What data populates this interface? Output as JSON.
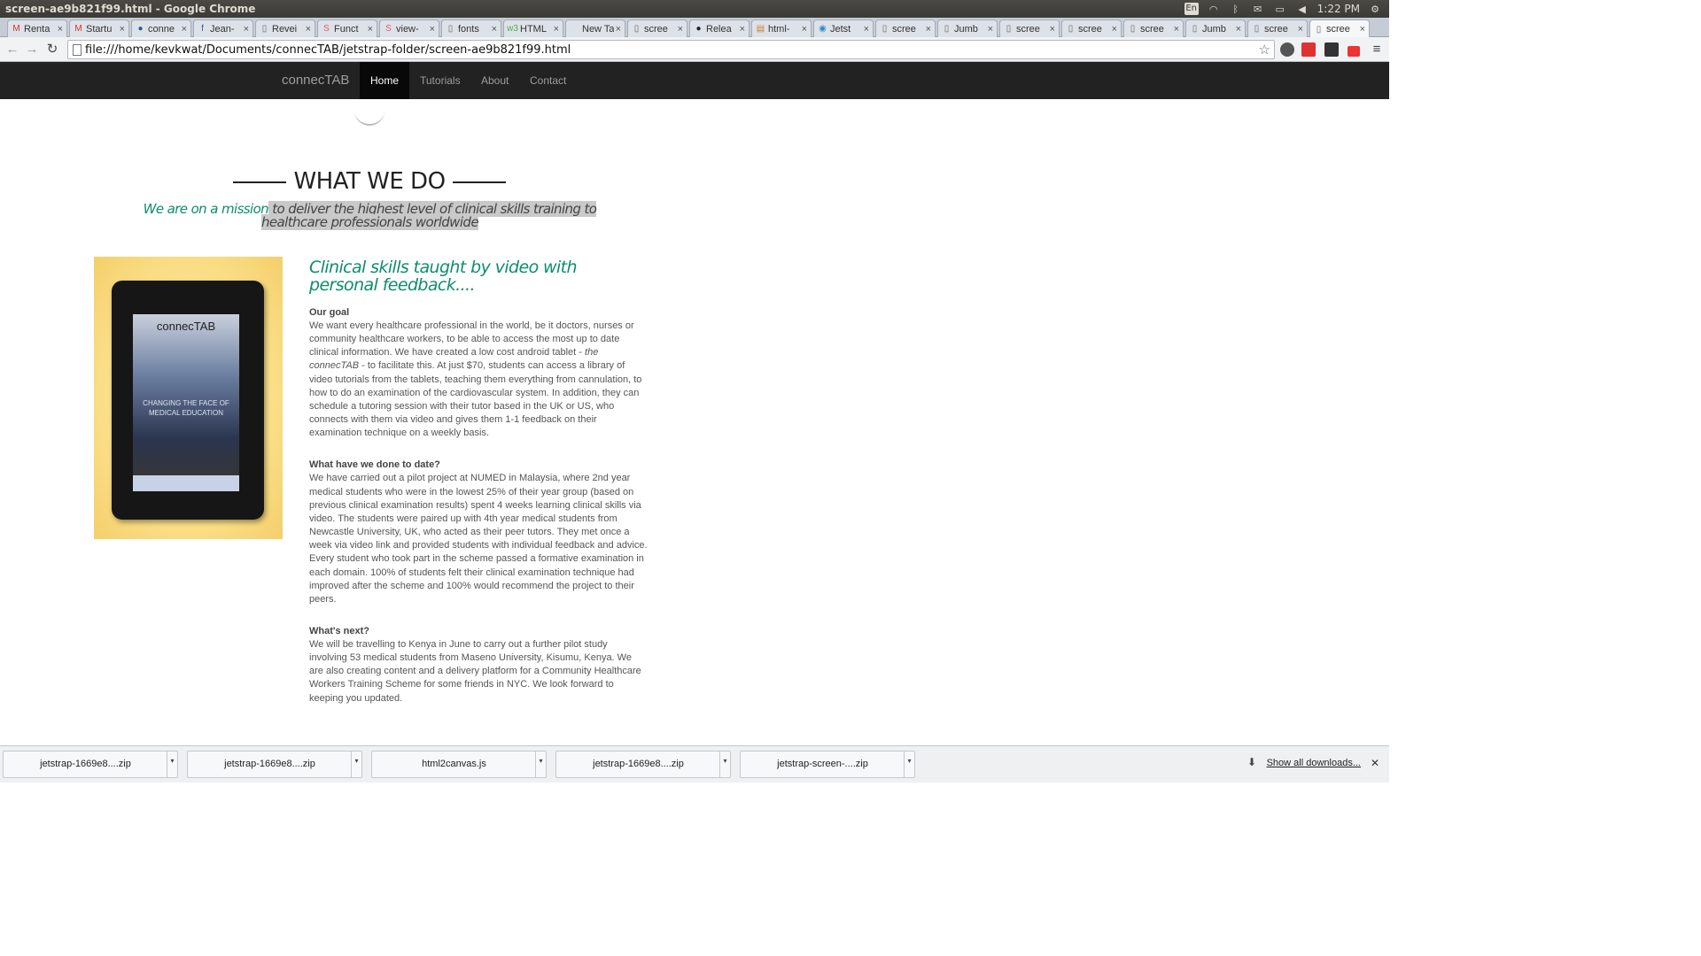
{
  "os": {
    "window_title": "screen-ae9b821f99.html - Google Chrome",
    "lang": "En",
    "time": "1:22 PM"
  },
  "tabs": [
    {
      "title": "Renta",
      "icon": "gmail-icon",
      "fav": "M",
      "color": "#d93025"
    },
    {
      "title": "Startu",
      "icon": "gmail-icon",
      "fav": "M",
      "color": "#d93025"
    },
    {
      "title": "conne",
      "icon": "page-icon",
      "fav": "●",
      "color": "#3b5998"
    },
    {
      "title": "Jean-",
      "icon": "facebook-icon",
      "fav": "f",
      "color": "#3b5998"
    },
    {
      "title": "Revei",
      "icon": "document-icon",
      "fav": "▯",
      "color": "#666"
    },
    {
      "title": "Funct",
      "icon": "s-icon",
      "fav": "S",
      "color": "#e05a6b"
    },
    {
      "title": "view-",
      "icon": "s-icon",
      "fav": "S",
      "color": "#e05a6b"
    },
    {
      "title": "fonts",
      "icon": "document-icon",
      "fav": "▯",
      "color": "#666"
    },
    {
      "title": "HTML",
      "icon": "w3-icon",
      "fav": "w3",
      "color": "#4caf50"
    },
    {
      "title": "New Tab",
      "icon": "",
      "fav": "",
      "color": "#666"
    },
    {
      "title": "scree",
      "icon": "document-icon",
      "fav": "▯",
      "color": "#666"
    },
    {
      "title": "Relea",
      "icon": "github-icon",
      "fav": "●",
      "color": "#222"
    },
    {
      "title": "html-",
      "icon": "html-icon",
      "fav": "▤",
      "color": "#c97d30"
    },
    {
      "title": "Jetst",
      "icon": "jetstrap-icon",
      "fav": "◉",
      "color": "#2a8ad4"
    },
    {
      "title": "scree",
      "icon": "document-icon",
      "fav": "▯",
      "color": "#666"
    },
    {
      "title": "Jumb",
      "icon": "document-icon",
      "fav": "▯",
      "color": "#666"
    },
    {
      "title": "scree",
      "icon": "document-icon",
      "fav": "▯",
      "color": "#666"
    },
    {
      "title": "scree",
      "icon": "document-icon",
      "fav": "▯",
      "color": "#666"
    },
    {
      "title": "scree",
      "icon": "document-icon",
      "fav": "▯",
      "color": "#666"
    },
    {
      "title": "Jumb",
      "icon": "document-icon",
      "fav": "▯",
      "color": "#666"
    },
    {
      "title": "scree",
      "icon": "document-icon",
      "fav": "▯",
      "color": "#666"
    },
    {
      "title": "scree",
      "icon": "document-icon",
      "fav": "▯",
      "color": "#666",
      "active": true
    }
  ],
  "toolbar": {
    "url": "file:///home/kevkwat/Documents/connecTAB/jetstrap-folder/screen-ae9b821f99.html"
  },
  "site": {
    "brand": "connecTAB",
    "nav": [
      {
        "label": "Home",
        "active": true
      },
      {
        "label": "Tutorials"
      },
      {
        "label": "About"
      },
      {
        "label": "Contact"
      }
    ],
    "heading": "WHAT WE DO",
    "mission_green": "We are on a mission",
    "mission_rest": " to deliver the highest level of clinical skills training to healthcare professionals worldwide",
    "tablet": {
      "logo": "connecTAB",
      "tagline": "CHANGING THE FACE OF MEDICAL EDUCATION"
    },
    "article_heading": "Clinical skills taught by video with personal feedback....",
    "sections": [
      {
        "title": "Our goal",
        "body_before": "We want every healthcare professional in the world, be it doctors, nurses or community healthcare workers, to be able to access the most up to date clinical information. We have created a low cost android tablet - ",
        "body_italic": "the connecTAB",
        "body_after": " - to facilitate this. At just $70, students can access a library of video tutorials from the tablets, teaching them everything from cannulation, to how to do an examination of the cardiovascular system. In addition, they can schedule a tutoring session with their tutor based in the UK or US, who connects with them via video and gives them 1-1 feedback on their examination technique on a weekly basis."
      },
      {
        "title": "What have we done to date?",
        "body_before": "We have carried out a pilot project at NUMED in Malaysia, where 2nd year medical students who were in the lowest 25% of their year group (based on previous clinical examination results) spent 4 weeks learning clinical skills via video. The students were paired up with 4th year medical students from Newcastle University, UK, who acted as their peer tutors. They met once a week via video link and provided students with individual feedback and advice. Every student who took part in the scheme passed a formative examination in each domain. 100% of students felt their clinical examination technique had improved after the scheme and 100% would recommend the project to their peers.",
        "body_italic": "",
        "body_after": ""
      },
      {
        "title": "What's next?",
        "body_before": "We will be travelling to Kenya in June to carry out a further pilot study involving 53 medical students from Maseno University, Kisumu, Kenya. We are also creating content and a delivery platform for a Community Healthcare Workers Training Scheme for some friends in NYC. We look forward to keeping you updated.",
        "body_italic": "",
        "body_after": ""
      }
    ]
  },
  "downloads": {
    "items": [
      "jetstrap-1669e8....zip",
      "jetstrap-1669e8....zip",
      "html2canvas.js",
      "jetstrap-1669e8....zip",
      "jetstrap-screen-....zip"
    ],
    "show_all": "Show all downloads..."
  },
  "colors": {
    "accent_green": "#0e8c6d",
    "navbar": "#222222"
  }
}
